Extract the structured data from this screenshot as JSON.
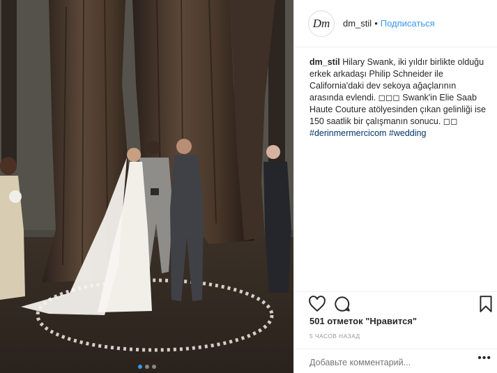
{
  "post": {
    "username": "dm_stil",
    "separator": "•",
    "follow_label": "Подписаться",
    "avatar_initials": "Dm",
    "caption": {
      "author": "dm_stil",
      "text": " Hilary Swank, iki yıldır birlikte olduğu erkek arkadaşı Philip Schneider ile California'daki dev sekoya ağaçlarının arasında evlendi. ◻◻◻ Swank'in Elie Saab Haute Couture atölyesinden çıkan gelinliği ise 150 saatlik bir çalışmanın sonucu. ◻◻",
      "hashtags": "#derinmermercicom #wedding"
    },
    "likes": "501 отметок \"Нравится\"",
    "time_ago": "5 ЧАСОВ НАЗАД",
    "comment_placeholder": "Добавьте комментарий...",
    "more_label": "•••",
    "carousel": {
      "count": 3,
      "active_index": 0
    }
  },
  "icons": {
    "like": "heart-icon",
    "comment": "comment-icon",
    "save": "bookmark-icon",
    "more": "more-options-icon"
  },
  "colors": {
    "link": "#3897f0",
    "hashtag": "#003569",
    "text": "#262626",
    "muted": "#999999"
  }
}
